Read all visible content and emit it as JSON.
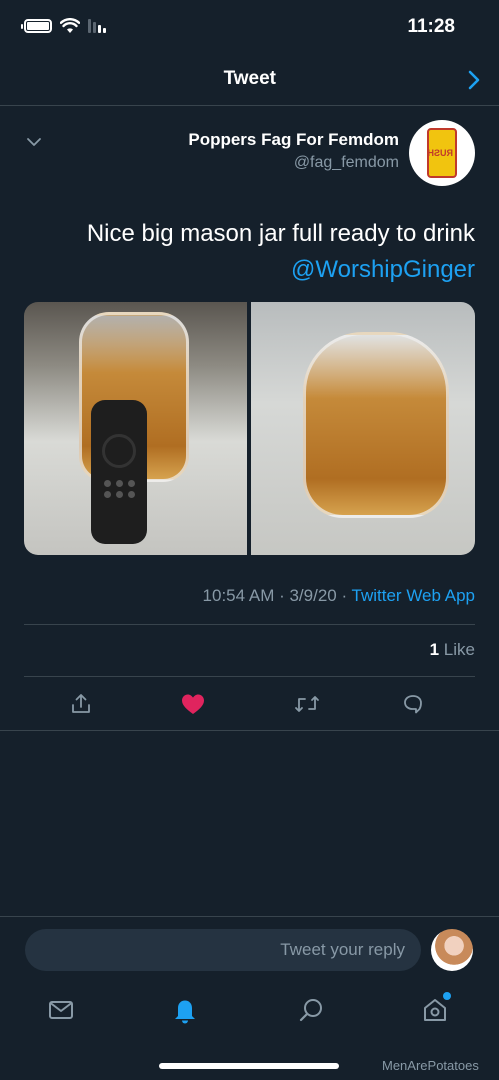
{
  "status_bar": {
    "time": "11:28"
  },
  "header": {
    "title": "Tweet"
  },
  "tweet": {
    "display_name": "Poppers Fag For Femdom",
    "handle": "@fag_femdom",
    "text_line1": "Nice big mason jar full ready to drink",
    "mention": "@WorshipGinger",
    "timestamp": "10:54 AM · 3/9/20 · ",
    "source": "Twitter Web App",
    "like_count": "1",
    "like_label": " Like"
  },
  "reply": {
    "placeholder": "Tweet your reply"
  },
  "watermark": "MenArePotatoes",
  "colors": {
    "accent": "#1da1f2",
    "like": "#e0245e",
    "background": "#15202b"
  },
  "icons": {
    "actions": [
      "reply-icon",
      "retweet-icon",
      "like-icon",
      "share-icon"
    ],
    "tabs": [
      "home-icon",
      "search-icon",
      "notifications-icon",
      "messages-icon"
    ]
  }
}
